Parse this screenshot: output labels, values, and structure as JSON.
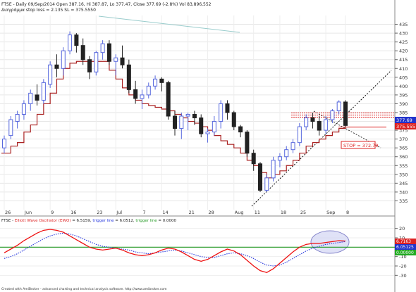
{
  "header": {
    "line1": "FTSE - Daily 09/Sep/2014 Open 387.16, Hi 387.87, Lo 377.47, Close 377.69 (-2.8%) Vol 83,896,552",
    "line2": "Διαγράμμα stop loss = 2.135 SL = 375.5550"
  },
  "indicator": {
    "name_prefix": "FTSE - ",
    "name": "Elliott Wave Oscillator (EWO)",
    "value": " = 6.5159, ",
    "trigger_label": "trigger line",
    "trigger_value": " = 6.0512, ",
    "trigger_label2": "trigger line",
    "trigger_value2": " = 0.0000"
  },
  "footer": "Created with AmiBroker - advanced charting and technical analysis software. http://www.amibroker.com",
  "annotations": {
    "stop_label": "STOP = 372.79"
  },
  "badges": {
    "close": "377.69",
    "sl": "375.555",
    "ewo": "6.7163",
    "trigger": "6.05125",
    "zero": "0.00000"
  },
  "colors": {
    "up": "#5566dd",
    "down": "#222222",
    "ma": "#aa2222",
    "ewo": "#ee1111",
    "trigger": "#2233dd",
    "zero": "#229922"
  },
  "chart_data": [
    {
      "type": "candlestick",
      "title": "FTSE - Daily",
      "ylim": [
        330,
        440
      ],
      "x_tick_labels": [
        "26",
        "Jun",
        "9",
        "16",
        "23",
        "Jul",
        "7",
        "14",
        "21",
        "28",
        "Aug",
        "11",
        "18",
        "25",
        "Sep",
        "8"
      ],
      "y_tick_labels": [
        "335",
        "340",
        "345",
        "350",
        "355",
        "360",
        "365",
        "370",
        "375",
        "380",
        "385",
        "390",
        "395",
        "400",
        "405",
        "410",
        "415",
        "420",
        "425",
        "430",
        "435"
      ],
      "ohlc": [
        {
          "o": 365,
          "h": 372,
          "l": 362,
          "c": 370
        },
        {
          "o": 372,
          "h": 383,
          "l": 370,
          "c": 381
        },
        {
          "o": 380,
          "h": 386,
          "l": 376,
          "c": 384
        },
        {
          "o": 384,
          "h": 392,
          "l": 381,
          "c": 390
        },
        {
          "o": 390,
          "h": 398,
          "l": 386,
          "c": 396
        },
        {
          "o": 395,
          "h": 401,
          "l": 389,
          "c": 392
        },
        {
          "o": 392,
          "h": 404,
          "l": 390,
          "c": 402
        },
        {
          "o": 401,
          "h": 414,
          "l": 399,
          "c": 412
        },
        {
          "o": 412,
          "h": 418,
          "l": 405,
          "c": 410
        },
        {
          "o": 410,
          "h": 422,
          "l": 406,
          "c": 420
        },
        {
          "o": 420,
          "h": 431,
          "l": 418,
          "c": 429
        },
        {
          "o": 429,
          "h": 430,
          "l": 419,
          "c": 423
        },
        {
          "o": 423,
          "h": 427,
          "l": 412,
          "c": 415
        },
        {
          "o": 415,
          "h": 417,
          "l": 404,
          "c": 408
        },
        {
          "o": 408,
          "h": 420,
          "l": 406,
          "c": 419
        },
        {
          "o": 419,
          "h": 426,
          "l": 415,
          "c": 424
        },
        {
          "o": 424,
          "h": 426,
          "l": 412,
          "c": 414
        },
        {
          "o": 414,
          "h": 418,
          "l": 406,
          "c": 416
        },
        {
          "o": 416,
          "h": 423,
          "l": 410,
          "c": 412
        },
        {
          "o": 412,
          "h": 415,
          "l": 396,
          "c": 398
        },
        {
          "o": 398,
          "h": 403,
          "l": 390,
          "c": 393
        },
        {
          "o": 393,
          "h": 398,
          "l": 387,
          "c": 395
        },
        {
          "o": 395,
          "h": 402,
          "l": 393,
          "c": 400
        },
        {
          "o": 400,
          "h": 406,
          "l": 398,
          "c": 404
        },
        {
          "o": 404,
          "h": 405,
          "l": 397,
          "c": 402
        },
        {
          "o": 402,
          "h": 403,
          "l": 381,
          "c": 383
        },
        {
          "o": 383,
          "h": 386,
          "l": 372,
          "c": 376
        },
        {
          "o": 376,
          "h": 385,
          "l": 370,
          "c": 383
        },
        {
          "o": 383,
          "h": 385,
          "l": 375,
          "c": 384
        },
        {
          "o": 384,
          "h": 386,
          "l": 378,
          "c": 382
        },
        {
          "o": 382,
          "h": 384,
          "l": 371,
          "c": 373
        },
        {
          "o": 373,
          "h": 376,
          "l": 368,
          "c": 374
        },
        {
          "o": 374,
          "h": 383,
          "l": 372,
          "c": 380
        },
        {
          "o": 380,
          "h": 392,
          "l": 376,
          "c": 390
        },
        {
          "o": 390,
          "h": 392,
          "l": 381,
          "c": 385
        },
        {
          "o": 385,
          "h": 386,
          "l": 375,
          "c": 377
        },
        {
          "o": 377,
          "h": 378,
          "l": 371,
          "c": 374
        },
        {
          "o": 374,
          "h": 375,
          "l": 360,
          "c": 362
        },
        {
          "o": 362,
          "h": 364,
          "l": 352,
          "c": 356
        },
        {
          "o": 356,
          "h": 357,
          "l": 340,
          "c": 341
        },
        {
          "o": 341,
          "h": 350,
          "l": 340,
          "c": 348
        },
        {
          "o": 348,
          "h": 360,
          "l": 346,
          "c": 358
        },
        {
          "o": 358,
          "h": 362,
          "l": 354,
          "c": 360
        },
        {
          "o": 360,
          "h": 366,
          "l": 358,
          "c": 364
        },
        {
          "o": 364,
          "h": 370,
          "l": 362,
          "c": 368
        },
        {
          "o": 368,
          "h": 379,
          "l": 366,
          "c": 377
        },
        {
          "o": 377,
          "h": 384,
          "l": 375,
          "c": 382
        },
        {
          "o": 382,
          "h": 385,
          "l": 376,
          "c": 380
        },
        {
          "o": 380,
          "h": 383,
          "l": 372,
          "c": 375
        },
        {
          "o": 375,
          "h": 383,
          "l": 373,
          "c": 381
        },
        {
          "o": 381,
          "h": 387,
          "l": 379,
          "c": 386
        },
        {
          "o": 386,
          "h": 392,
          "l": 384,
          "c": 391
        },
        {
          "o": 391,
          "h": 392,
          "l": 377,
          "c": 377.69
        }
      ],
      "series": [
        {
          "name": "SL",
          "values": [
            362,
            366,
            368,
            374,
            378,
            384,
            390,
            396,
            404,
            410,
            413,
            414,
            414,
            414,
            414,
            414,
            409,
            404,
            399,
            395,
            392,
            390,
            389,
            388,
            387,
            386,
            384,
            382,
            380,
            379,
            377,
            375,
            372,
            369,
            367,
            365,
            362,
            358,
            355,
            351,
            348,
            350,
            352,
            355,
            358,
            362,
            366,
            368,
            370,
            372,
            374,
            376,
            377
          ]
        }
      ],
      "levels": {
        "stop": 372.79,
        "resistance": 384
      }
    },
    {
      "type": "line",
      "title": "Elliott Wave Oscillator (EWO)",
      "ylim": [
        -35,
        25
      ],
      "y_tick_labels": [
        "20",
        "10",
        "0",
        "-10",
        "-20",
        "-30"
      ],
      "series": [
        {
          "name": "Elliott Wave Oscillator (EWO)",
          "values": [
            -6,
            -2,
            2,
            7,
            11,
            15,
            18,
            19,
            18,
            16,
            12,
            8,
            4,
            0,
            -2,
            -3,
            -2,
            -1,
            -3,
            -6,
            -8,
            -9,
            -8,
            -6,
            -3,
            -1,
            -2,
            -5,
            -9,
            -13,
            -15,
            -13,
            -9,
            -5,
            -2,
            -4,
            -8,
            -14,
            -20,
            -25,
            -27,
            -23,
            -17,
            -11,
            -5,
            0,
            3,
            4,
            4,
            5,
            6,
            7,
            6.5159
          ]
        },
        {
          "name": "trigger line",
          "values": [
            -12,
            -10,
            -7,
            -3,
            1,
            5,
            9,
            12,
            14,
            15,
            14,
            12,
            9,
            6,
            3,
            1,
            0,
            -1,
            -2,
            -3,
            -5,
            -6,
            -7,
            -6,
            -5,
            -4,
            -3,
            -4,
            -6,
            -8,
            -10,
            -11,
            -11,
            -9,
            -7,
            -6,
            -7,
            -9,
            -12,
            -16,
            -19,
            -20,
            -19,
            -16,
            -12,
            -8,
            -4,
            -1,
            1,
            3,
            4,
            5,
            6.0512
          ]
        },
        {
          "name": "trigger line",
          "values": [
            0,
            0,
            0,
            0,
            0,
            0,
            0,
            0,
            0,
            0,
            0,
            0,
            0,
            0,
            0,
            0,
            0,
            0,
            0,
            0,
            0,
            0,
            0,
            0,
            0,
            0,
            0,
            0,
            0,
            0,
            0,
            0,
            0,
            0,
            0,
            0,
            0,
            0,
            0,
            0,
            0,
            0,
            0,
            0,
            0,
            0,
            0,
            0,
            0,
            0,
            0,
            0,
            0
          ]
        }
      ]
    }
  ]
}
